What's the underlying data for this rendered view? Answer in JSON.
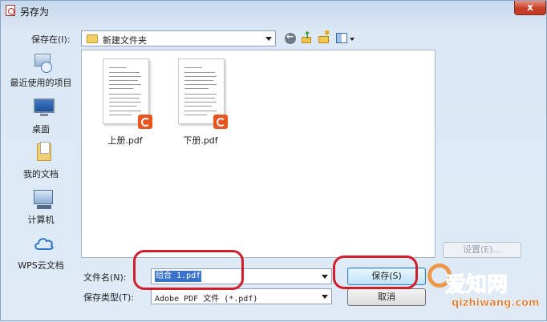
{
  "window": {
    "title": "另存为",
    "close_glyph": "x"
  },
  "toolbar": {
    "lookin_label": "保存在(I):",
    "lookin_value": "新建文件夹",
    "icons": [
      "back-icon",
      "up-folder-icon",
      "new-folder-icon",
      "views-menu-icon"
    ]
  },
  "places": [
    {
      "label": "最近使用的项目",
      "icon": "recent-items-icon"
    },
    {
      "label": "桌面",
      "icon": "desktop-icon"
    },
    {
      "label": "我的文档",
      "icon": "my-documents-icon"
    },
    {
      "label": "计算机",
      "icon": "computer-icon"
    },
    {
      "label": "WPS云文档",
      "icon": "cloud-icon"
    }
  ],
  "files": [
    {
      "name": "上册.pdf",
      "icon": "pdf-icon"
    },
    {
      "name": "下册.pdf",
      "icon": "pdf-icon"
    }
  ],
  "options_button": "设置(E)...",
  "form": {
    "filename_label": "文件名(N):",
    "filename_value": "组合 1.pdf",
    "filetype_label": "保存类型(T):",
    "filetype_value": "Adobe PDF 文件 (*.pdf)"
  },
  "buttons": {
    "save": "保存(S)",
    "cancel": "取消"
  },
  "watermark": {
    "text": "爱知网",
    "url": "qizhiwang.com"
  },
  "colors": {
    "title_bar": "#c7d9ee",
    "close": "#c8402a",
    "selection": "#3a73c9",
    "annotation": "#d01e2a",
    "watermark": "#e07c28"
  }
}
